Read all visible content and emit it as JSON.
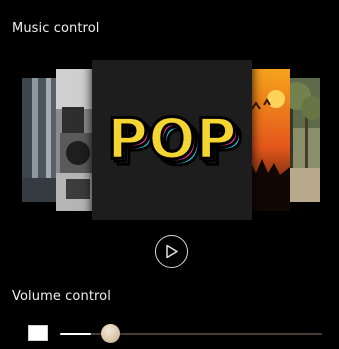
{
  "music_control": {
    "title": "Music control",
    "cover_text": "POP",
    "cards": [
      {
        "name": "album-cover-far-left"
      },
      {
        "name": "album-cover-left"
      },
      {
        "name": "album-cover-center-pop"
      },
      {
        "name": "album-cover-right"
      },
      {
        "name": "album-cover-far-right"
      }
    ],
    "play_icon": "play-icon"
  },
  "volume_control": {
    "title": "Volume control",
    "level": 0.12,
    "icon": "volume-icon"
  },
  "colors": {
    "background": "#000000",
    "text": "#f0f0f0",
    "track": "#4a3d35",
    "thumb": "#d6c6a8",
    "pop_yellow": "#f5d531",
    "pop_pink": "#e8328f",
    "pop_cyan": "#22c7e8"
  }
}
